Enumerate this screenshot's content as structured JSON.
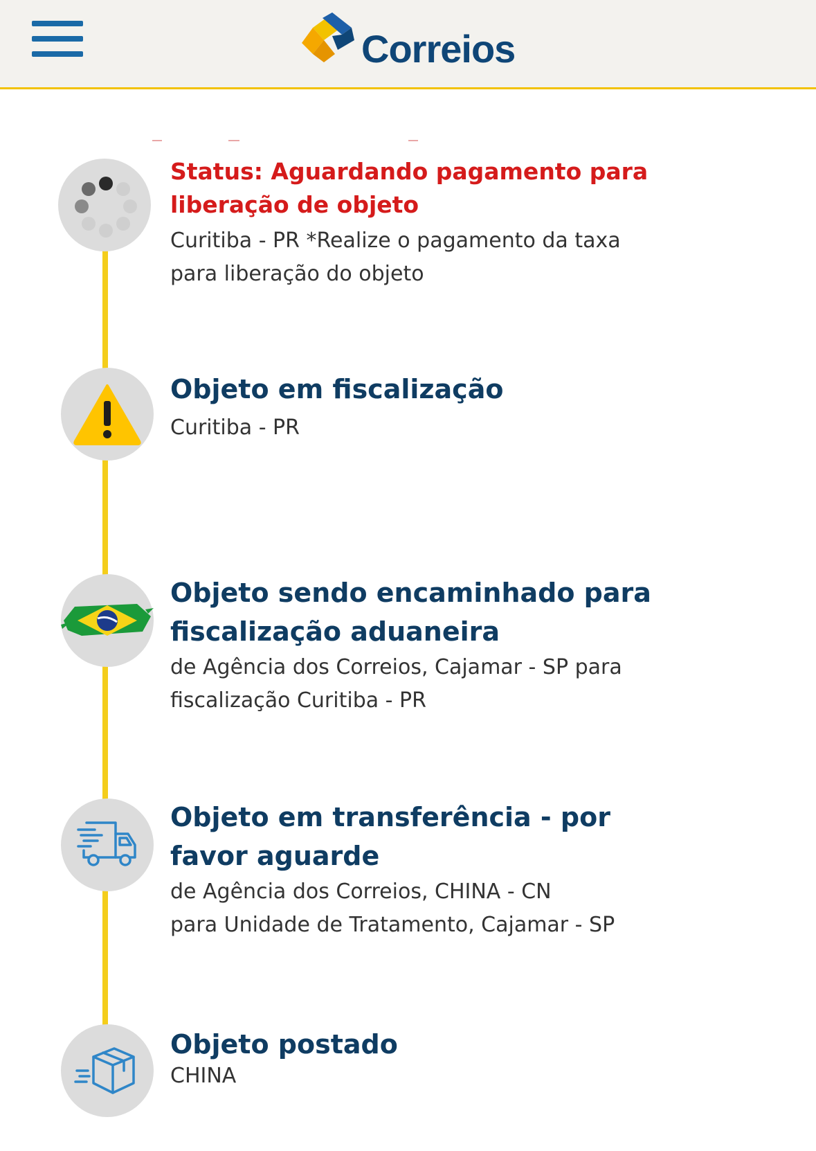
{
  "header": {
    "menu_icon": "hamburger-menu-icon",
    "logo_text": "Correios",
    "colors": {
      "background": "#f3f2ee",
      "accent": "#f2c200",
      "brand_blue": "#0f4677"
    }
  },
  "timeline": {
    "line_color": "#f4cd1b",
    "events": [
      {
        "icon": "loading-spinner-icon",
        "title": "Status: Aguardando pagamento para liberação de objeto",
        "title_color": "#d51b1b",
        "desc_lines": [
          "Curitiba - PR *Realize o pagamento da taxa",
          "para liberação do objeto"
        ]
      },
      {
        "icon": "warning-icon",
        "title": "Objeto em fiscalização",
        "desc_lines": [
          "Curitiba - PR"
        ]
      },
      {
        "icon": "brazil-flag-icon",
        "title": "Objeto sendo encaminhado para fiscalização aduaneira",
        "desc_lines": [
          "de Agência dos Correios, Cajamar - SP para",
          "fiscalização Curitiba - PR"
        ]
      },
      {
        "icon": "delivery-truck-icon",
        "title": "Objeto em transferência - por favor aguarde",
        "desc_lines": [
          "de Agência dos Correios, CHINA - CN",
          "para Unidade de Tratamento, Cajamar - SP"
        ]
      },
      {
        "icon": "package-box-icon",
        "title": "Objeto postado",
        "desc_lines": [
          "CHINA"
        ]
      }
    ]
  }
}
